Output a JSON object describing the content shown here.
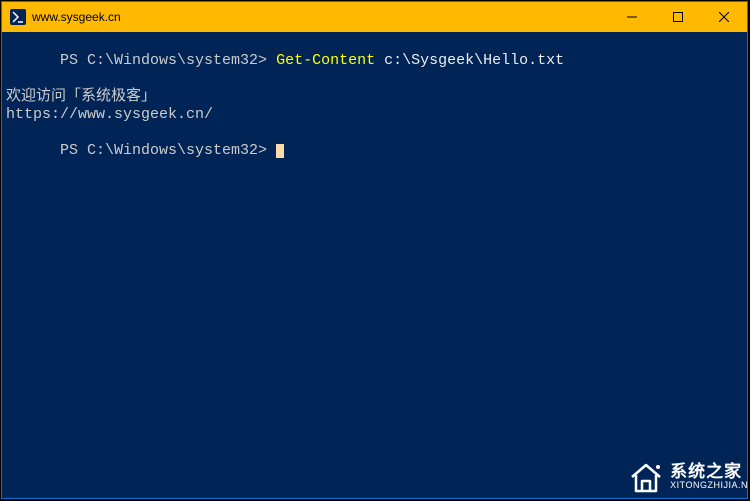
{
  "window": {
    "title": "www.sysgeek.cn",
    "icon_label": "powershell-icon"
  },
  "terminal": {
    "lines": [
      {
        "prompt": "PS C:\\Windows\\system32> ",
        "command": "Get-Content",
        "args": " c:\\Sysgeek\\Hello.txt"
      },
      {
        "text": "欢迎访问「系统极客」"
      },
      {
        "text": ""
      },
      {
        "text": "https://www.sysgeek.cn/"
      },
      {
        "prompt": "PS C:\\Windows\\system32> ",
        "cursor": true
      }
    ]
  },
  "watermark": {
    "main": "系统之家",
    "sub": "XITONGZHIJIA.N"
  }
}
